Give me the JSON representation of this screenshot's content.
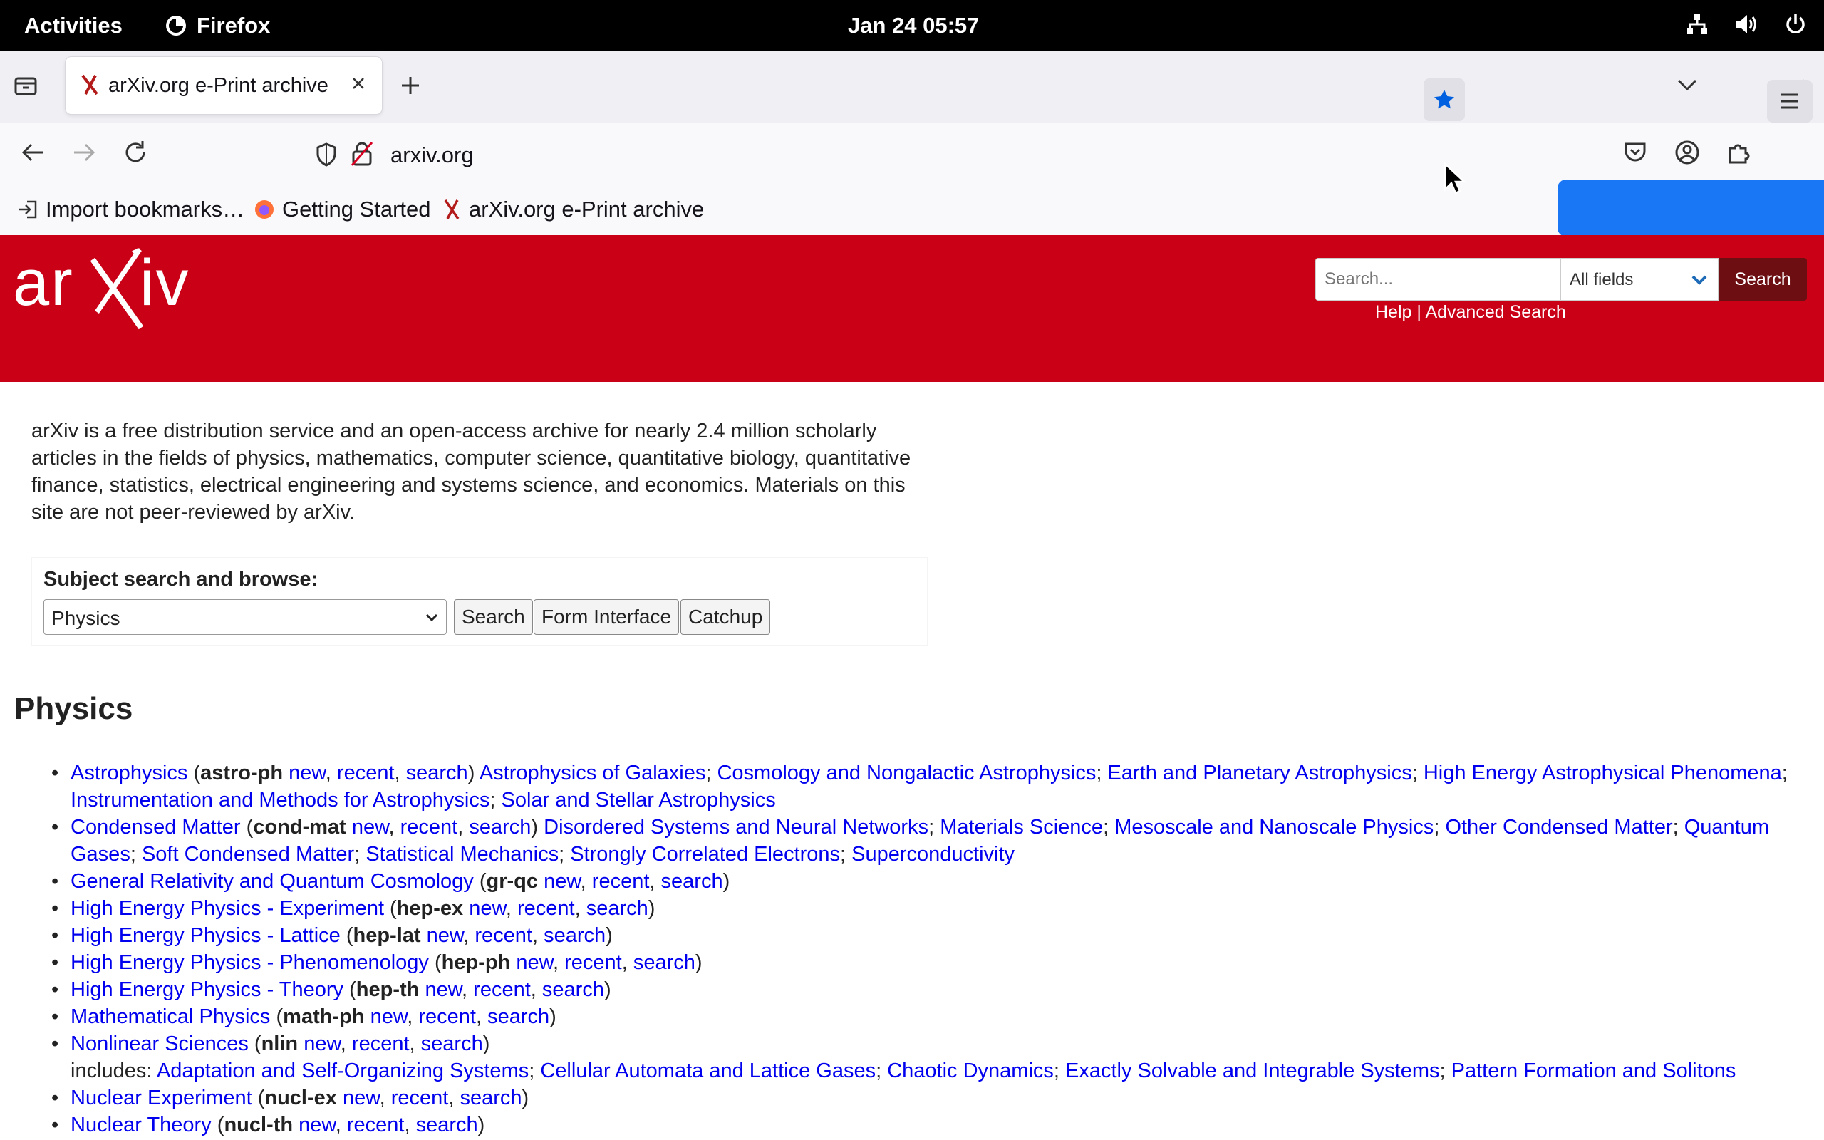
{
  "topbar": {
    "activities": "Activities",
    "app_name": "Firefox",
    "clock": "Jan 24  05:57"
  },
  "browser": {
    "tab_title": "arXiv.org e-Print archive",
    "url": "arxiv.org",
    "bookmarks": [
      "Import bookmarks…",
      "Getting Started",
      "arXiv.org e-Print archive"
    ]
  },
  "header": {
    "search_placeholder": "Search...",
    "field_select": "All fields",
    "search_button": "Search",
    "help_link": "Help",
    "separator": " | ",
    "advanced_link": "Advanced Search"
  },
  "intro": "arXiv is a free distribution service and an open-access archive for nearly 2.4 million scholarly articles in the fields of physics, mathematics, computer science, quantitative biology, quantitative finance, statistics, electrical engineering and systems science, and economics. Materials on this site are not peer-reviewed by arXiv.",
  "browse": {
    "label": "Subject search and browse:",
    "selected": "Physics",
    "search_button": "Search",
    "form_button": "Form Interface",
    "catchup_button": "Catchup"
  },
  "section_title": "Physics",
  "categories": [
    {
      "name": "Astrophysics",
      "code": "astro-ph",
      "links": [
        "new",
        "recent",
        "search"
      ],
      "subs": [
        "Astrophysics of Galaxies",
        "Cosmology and Nongalactic Astrophysics",
        "Earth and Planetary Astrophysics",
        "High Energy Astrophysical Phenomena",
        "Instrumentation and Methods for Astrophysics",
        "Solar and Stellar Astrophysics"
      ]
    },
    {
      "name": "Condensed Matter",
      "code": "cond-mat",
      "links": [
        "new",
        "recent",
        "search"
      ],
      "subs": [
        "Disordered Systems and Neural Networks",
        "Materials Science",
        "Mesoscale and Nanoscale Physics",
        "Other Condensed Matter",
        "Quantum Gases",
        "Soft Condensed Matter",
        "Statistical Mechanics",
        "Strongly Correlated Electrons",
        "Superconductivity"
      ]
    },
    {
      "name": "General Relativity and Quantum Cosmology",
      "code": "gr-qc",
      "links": [
        "new",
        "recent",
        "search"
      ]
    },
    {
      "name": "High Energy Physics - Experiment",
      "code": "hep-ex",
      "links": [
        "new",
        "recent",
        "search"
      ]
    },
    {
      "name": "High Energy Physics - Lattice",
      "code": "hep-lat",
      "links": [
        "new",
        "recent",
        "search"
      ]
    },
    {
      "name": "High Energy Physics - Phenomenology",
      "code": "hep-ph",
      "links": [
        "new",
        "recent",
        "search"
      ]
    },
    {
      "name": "High Energy Physics - Theory",
      "code": "hep-th",
      "links": [
        "new",
        "recent",
        "search"
      ]
    },
    {
      "name": "Mathematical Physics",
      "code": "math-ph",
      "links": [
        "new",
        "recent",
        "search"
      ]
    },
    {
      "name": "Nonlinear Sciences",
      "code": "nlin",
      "links": [
        "new",
        "recent",
        "search"
      ],
      "includes_label": "includes:",
      "includes": [
        "Adaptation and Self-Organizing Systems",
        "Cellular Automata and Lattice Gases",
        "Chaotic Dynamics",
        "Exactly Solvable and Integrable Systems",
        "Pattern Formation and Solitons"
      ]
    },
    {
      "name": "Nuclear Experiment",
      "code": "nucl-ex",
      "links": [
        "new",
        "recent",
        "search"
      ]
    },
    {
      "name": "Nuclear Theory",
      "code": "nucl-th",
      "links": [
        "new",
        "recent",
        "search"
      ]
    }
  ],
  "colors": {
    "arxiv_red": "#c90016",
    "link_blue": "#0000ee",
    "popup_blue": "#1976f5"
  }
}
